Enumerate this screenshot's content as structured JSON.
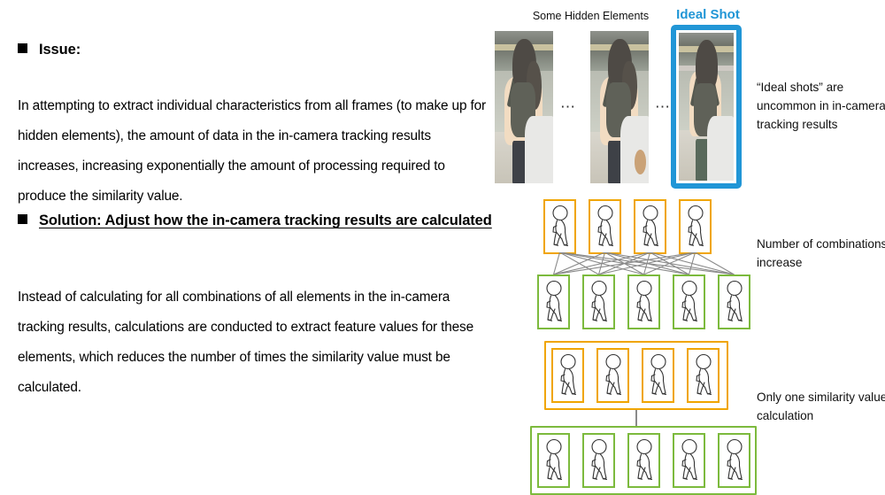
{
  "slide": {
    "issue": {
      "bullet_label": "Issue:",
      "body": "In attempting to extract individual characteristics from all frames (to make up for hidden elements), the amount of data in the in-camera tracking results increases, increasing exponentially the amount of processing required to produce the similarity value."
    },
    "solution": {
      "bullet_label": "Solution: Adjust how the in-camera tracking results are calculated",
      "body": "Instead of calculating for all combinations of all elements in the in-camera tracking results, calculations are conducted to extract feature values for these elements, which reduces the number of times the similarity value must be calculated."
    }
  },
  "photo_panel": {
    "caption_hidden": "Some Hidden Elements",
    "caption_ideal": "Ideal Shot",
    "ellipsis": "⋯",
    "note": "“Ideal shots” are uncommon in in-camera tracking results",
    "ideal_border_color": "#2196d6",
    "photos": [
      {
        "name": "hidden-frame-1",
        "alt": "surveillance crop of person with backpack, partially occluded"
      },
      {
        "name": "hidden-frame-2",
        "alt": "surveillance crop of person with backpack, partially occluded"
      },
      {
        "name": "ideal-frame",
        "alt": "surveillance crop of person with backpack, fully visible"
      }
    ]
  },
  "diagrams": {
    "combinations": {
      "note": "Number of combinations increase",
      "top_row_count": 4,
      "bottom_row_count": 5,
      "top_row_color": "#f0a500",
      "bottom_row_color": "#7cba3d",
      "link_count": 20,
      "grouped": false
    },
    "single": {
      "note": "Only one similarity value calculation",
      "top_row_count": 4,
      "bottom_row_count": 5,
      "top_row_color": "#f0a500",
      "bottom_row_color": "#7cba3d",
      "link_count": 1,
      "grouped": true
    }
  }
}
